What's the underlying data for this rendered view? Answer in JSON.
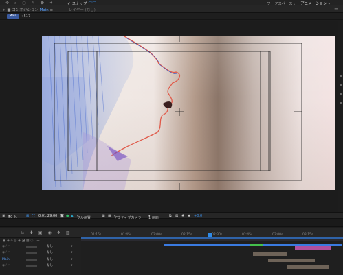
{
  "topbar": {
    "tool_icons": "✥ ⌕ ▢ ✎ ⬟ ✦",
    "snap_check": "✓",
    "snap_label": "スナップ",
    "workspace_label": "ワークスペース :",
    "workspace_value": "アニメーション",
    "dropdown_glyph": "▾"
  },
  "panel": {
    "close_glyph": "×",
    "lock_glyph": "■",
    "comp_label": "コンポジション",
    "comp_name": "Main",
    "layer_label": "レイヤー (なし)",
    "menu_glyph": "≡"
  },
  "tabs": {
    "active": "Main",
    "separator": "‹",
    "crumb": "517"
  },
  "viewerbar": {
    "zoom": "50 %",
    "timecode": "0:01:29:00",
    "resolution": "フル画質",
    "camera": "アクティブカメラ",
    "views": "1 画面",
    "exposure": "+0.0"
  },
  "timeline": {
    "ruler_labels": [
      "01:15s",
      "01:45s",
      "02:00s",
      "02:15s",
      "02:30s",
      "02:45s",
      "03:00s",
      "03:15s"
    ],
    "layers": [
      {
        "parent": "なし",
        "dropdown": "▾"
      },
      {
        "parent": "なし",
        "dropdown": "▾"
      },
      {
        "name": "Main",
        "parent": "なし",
        "dropdown": "▾"
      },
      {
        "parent": "なし",
        "dropdown": "▾"
      }
    ]
  },
  "colors": {
    "accent_blue": "#2f8ae6",
    "playhead_red": "#d32e2e",
    "tab_active": "#3b5ba0"
  }
}
